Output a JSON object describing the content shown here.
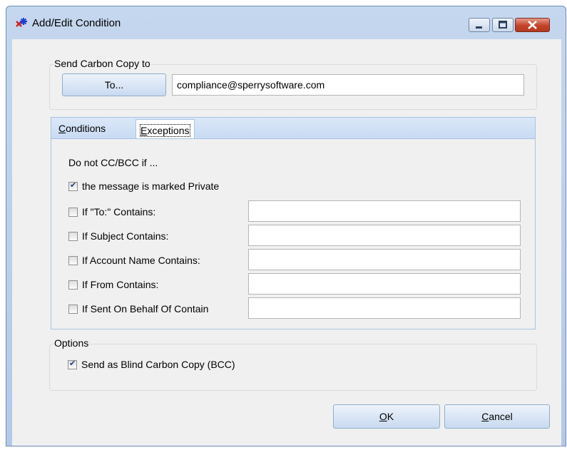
{
  "window": {
    "title": "Add/Edit Condition"
  },
  "send_cc": {
    "group_title": "Send Carbon Copy to",
    "to_button_label": "To...",
    "address_value": "compliance@sperrysoftware.com"
  },
  "tabs": [
    {
      "label": "Conditions",
      "active": false
    },
    {
      "label": "Exceptions",
      "active": true
    }
  ],
  "exceptions": {
    "heading": "Do not CC/BCC if ...",
    "private_checkbox": {
      "label": "the message is marked Private",
      "checked": true
    },
    "rows": [
      {
        "label": "If \"To:\" Contains:",
        "checked": false,
        "value": ""
      },
      {
        "label": "If Subject Contains:",
        "checked": false,
        "value": ""
      },
      {
        "label": "If Account Name Contains:",
        "checked": false,
        "value": ""
      },
      {
        "label": "If From Contains:",
        "checked": false,
        "value": ""
      },
      {
        "label": "If Sent On Behalf Of Contain",
        "checked": false,
        "value": ""
      }
    ]
  },
  "options": {
    "group_title": "Options",
    "bcc_checkbox": {
      "label": "Send as Blind Carbon Copy (BCC)",
      "checked": true
    }
  },
  "buttons": {
    "ok_label": "OK",
    "cancel_label": "Cancel"
  },
  "colors": {
    "titlebar": "#c4d7ee",
    "client": "#f0f0f0",
    "tab_strip": "#dbe7f7",
    "close_button": "#c4422a"
  }
}
